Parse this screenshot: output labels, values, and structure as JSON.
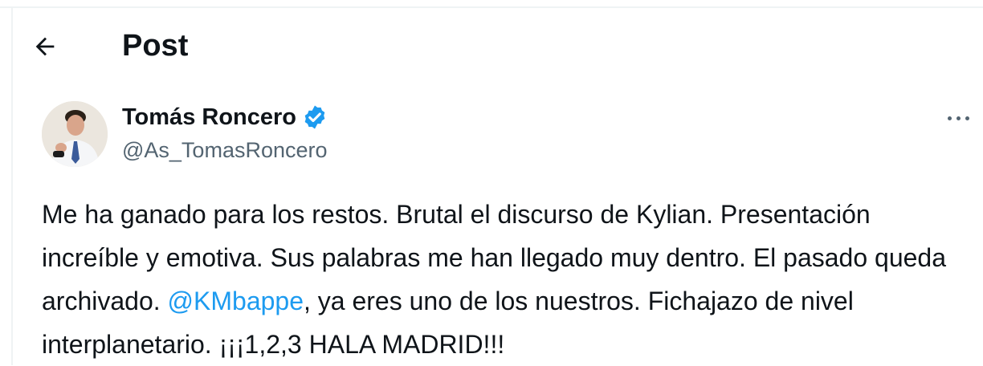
{
  "header": {
    "back_icon": "arrow-left-icon",
    "title": "Post"
  },
  "author": {
    "avatar_icon": "profile-photo",
    "name": "Tomás Roncero",
    "verified_icon": "verified-badge-icon",
    "verified_color": "#1d9bf0",
    "handle": "@As_TomasRoncero"
  },
  "more_icon": "more-horizontal-icon",
  "post": {
    "text_before": "Me ha ganado para los restos. Brutal el discurso de Kylian. Presentación increíble y emotiva. Sus palabras me han llegado muy dentro. El pasado queda archivado. ",
    "mention": "@KMbappe",
    "mention_color": "#1d9bf0",
    "text_after": ", ya eres uno de los nuestros. Fichajazo de nivel interplanetario. ¡¡¡1,2,3 HALA MADRID!!!"
  }
}
